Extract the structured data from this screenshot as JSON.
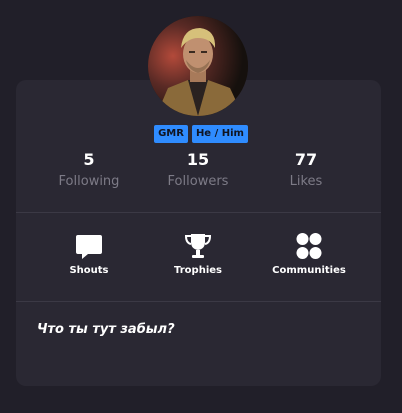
{
  "profile": {
    "badges": [
      "GMR",
      "He / Him"
    ],
    "stats": [
      {
        "value": "5",
        "label": "Following"
      },
      {
        "value": "15",
        "label": "Followers"
      },
      {
        "value": "77",
        "label": "Likes"
      }
    ],
    "actions": [
      {
        "label": "Shouts",
        "icon": "speech-bubble-icon"
      },
      {
        "label": "Trophies",
        "icon": "trophy-icon"
      },
      {
        "label": "Communities",
        "icon": "communities-icon"
      }
    ],
    "status": "Что ты тут забыл?"
  },
  "colors": {
    "background": "#211f29",
    "card": "#2a2833",
    "badge": "#2f8cff",
    "muted_text": "#7d7b87"
  }
}
